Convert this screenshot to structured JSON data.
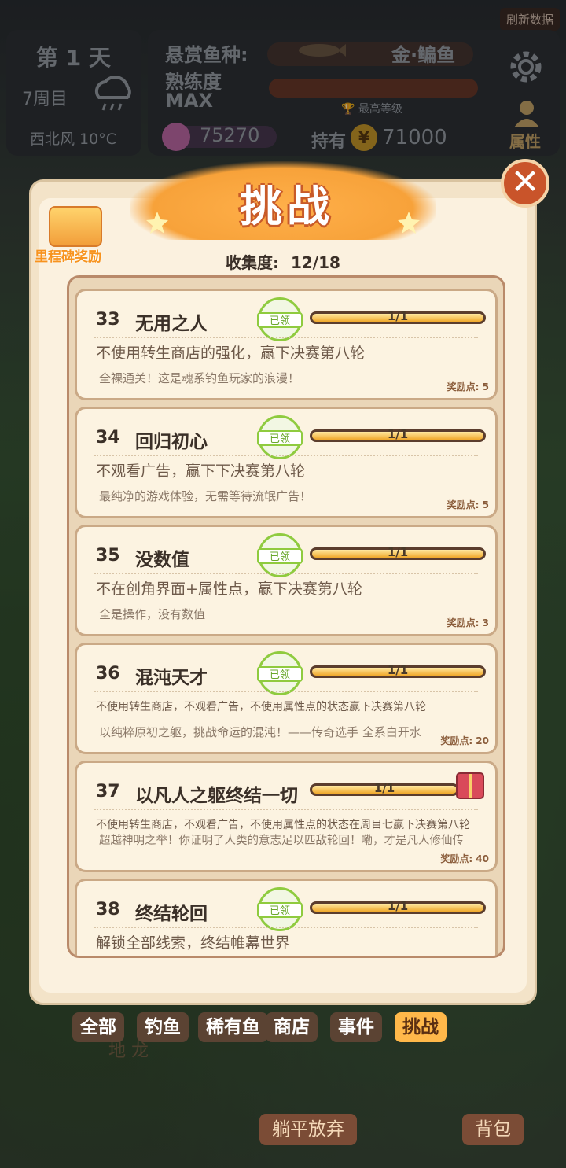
{
  "hud": {
    "refresh_label": "刷新数据",
    "day": "第 1 天",
    "week": "7周目",
    "weather": "西北风 10°C",
    "bounty_label": "悬赏鱼种:",
    "bounty_fish": "金·鳊鱼",
    "proficiency_label": "熟练度",
    "proficiency_value": "MAX",
    "max_level": "最高等级",
    "shells": "75270",
    "hold_label": "持有",
    "coins": "71000",
    "attr_label": "属性"
  },
  "panel": {
    "title": "挑战",
    "milestone_label": "里程碑奖励",
    "collection_label": "收集度:",
    "collection_value": "12/18",
    "claimed_label": "已领"
  },
  "challenges": [
    {
      "num": "33",
      "name": "无用之人",
      "desc": "不使用转生商店的强化，赢下决赛第八轮",
      "flavor": "全裸通关！这是魂系钓鱼玩家的浪漫！",
      "progress": "1/1",
      "reward": "奖励点: 5",
      "claimed": true
    },
    {
      "num": "34",
      "name": "回归初心",
      "desc": "不观看广告，赢下下决赛第八轮",
      "flavor": "最纯净的游戏体验，无需等待流氓广告！",
      "progress": "1/1",
      "reward": "奖励点: 5",
      "claimed": true
    },
    {
      "num": "35",
      "name": "没数值",
      "desc": "不在创角界面+属性点，赢下决赛第八轮",
      "flavor": "全是操作，没有数值",
      "progress": "1/1",
      "reward": "奖励点: 3",
      "claimed": true
    },
    {
      "num": "36",
      "name": "混沌天才",
      "desc": "不使用转生商店，不观看广告，不使用属性点的状态赢下决赛第八轮",
      "flavor": "以纯粹原初之躯，挑战命运的混沌！——传奇选手 全系白开水",
      "progress": "1/1",
      "reward": "奖励点: 20",
      "claimed": true
    },
    {
      "num": "37",
      "name": "以凡人之躯终结一切",
      "desc": "不使用转生商店，不观看广告，不使用属性点的状态在周目七赢下决赛第八轮",
      "flavor": "超越神明之举！你证明了人类的意志足以匹敌轮回！嘞，才是凡人修仙传",
      "progress": "1/1",
      "reward": "奖励点: 40",
      "claimed": false
    },
    {
      "num": "38",
      "name": "终结轮回",
      "desc": "解锁全部线索，终结帷幕世界",
      "flavor": "",
      "progress": "1/1",
      "reward": "",
      "claimed": true
    }
  ],
  "tabs": [
    "全部",
    "钓鱼",
    "稀有鱼",
    "商店",
    "事件",
    "挑战"
  ],
  "bottom": {
    "give_up": "躺平放弃",
    "bag": "背包",
    "map": "地 龙"
  },
  "colors": {
    "accent": "#ffb84a",
    "stamp": "#8fcb3f",
    "close": "#c9542a"
  }
}
